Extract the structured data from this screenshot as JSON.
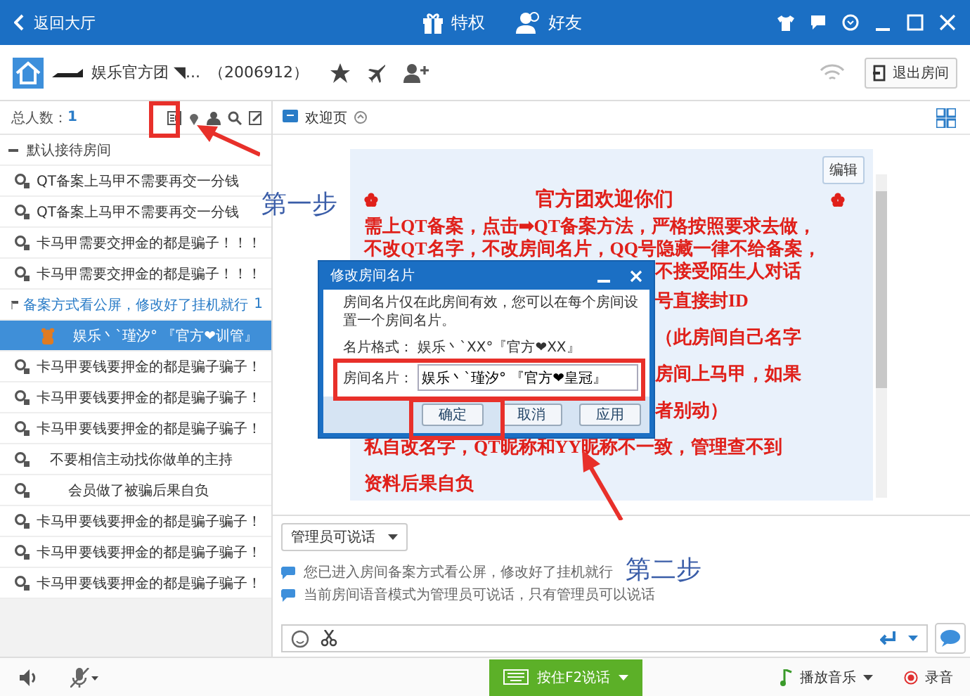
{
  "title_bar": {
    "back": "返回大厅",
    "tabs": [
      {
        "label": "特权",
        "kind": "gift"
      },
      {
        "label": "好友",
        "kind": "friends"
      }
    ]
  },
  "room_header": {
    "name": "娱乐官方团 ◥...",
    "id": "（2006912）",
    "exit_button": "退出房间"
  },
  "member_bar": {
    "count_label": "总人数：",
    "count": "1"
  },
  "page_tab": {
    "label": "欢迎页"
  },
  "channel_list": {
    "header": "默认接待房间",
    "items": [
      {
        "kind": "channel",
        "label": "QT备案上马甲不需要再交一分钱",
        "selected": false
      },
      {
        "kind": "channel",
        "label": "QT备案上马甲不需要再交一分钱",
        "selected": false
      },
      {
        "kind": "channel",
        "label": "卡马甲需要交押金的都是骗子！！！",
        "selected": false
      },
      {
        "kind": "channel",
        "label": "卡马甲需要交押金的都是骗子！！！",
        "selected": false
      },
      {
        "kind": "group",
        "label": "备案方式看公屏，修改好了挂机就行",
        "badge": "1",
        "selected": false,
        "children": [
          {
            "label": "娱乐丶`瑾汐° 『官方❤训管』",
            "selected": true
          }
        ]
      },
      {
        "kind": "channel",
        "label": "卡马甲要钱要押金的都是骗子骗子！",
        "selected": false
      },
      {
        "kind": "channel",
        "label": "卡马甲要钱要押金的都是骗子骗子！",
        "selected": false
      },
      {
        "kind": "channel",
        "label": "卡马甲要钱要押金的都是骗子骗子！",
        "selected": false
      },
      {
        "kind": "channel",
        "label": "   不要相信主动找你做单的主持",
        "selected": false
      },
      {
        "kind": "channel",
        "label": "       会员做了被骗后果自负",
        "selected": false
      },
      {
        "kind": "channel",
        "label": "卡马甲要钱要押金的都是骗子骗子！",
        "selected": false
      },
      {
        "kind": "channel",
        "label": "卡马甲要钱要押金的都是骗子骗子！",
        "selected": false
      },
      {
        "kind": "channel",
        "label": "卡马甲要钱要押金的都是骗子骗子！",
        "selected": false
      }
    ]
  },
  "welcome_panel": {
    "edit_button": "编辑",
    "title": "官方团欢迎你们",
    "lines": [
      {
        "kind": "full",
        "text": "需上QT备案，点击➡QT备案方法，严格按照要求去做，"
      },
      {
        "kind": "full",
        "text": "不改QT名字，不改房间名片，QQ号隐藏一律不给备案，"
      },
      {
        "kind": "partial",
        "text": "不接受陌生人对话"
      },
      {
        "kind": "partial",
        "text": "号直接封ID"
      },
      {
        "kind": "partial",
        "text": "（此房间自己名字"
      },
      {
        "kind": "partial",
        "text": "房间上马甲，如果"
      },
      {
        "kind": "partial",
        "text": "者别动）"
      },
      {
        "kind": "full",
        "text": "私自改名字，QT昵称和YY昵称不一致，管理查不到"
      },
      {
        "kind": "full",
        "text": "资料后果自负"
      }
    ]
  },
  "dialog": {
    "title": "修改房间名片",
    "description": "房间名片仅在此房间有效，您可以在每个房间设置一个房间名片。",
    "format_label": "名片格式：",
    "format_value": "娱乐丶`XX°『官方❤XX』",
    "name_label": "房间名片：",
    "name_value": "娱乐丶`瑾汐° 『官方❤皇冠』",
    "buttons": [
      "确定",
      "取消",
      "应用"
    ]
  },
  "chat": {
    "mode_select": "管理员可说话",
    "messages": [
      "您已进入房间备案方式看公屏，修改好了挂机就行",
      "当前房间语音模式为管理员可说话，只有管理员可以说话"
    ]
  },
  "bottom_bar": {
    "talk_button": "按住F2说话",
    "music": "播放音乐",
    "record": "录音"
  },
  "annotations": [
    {
      "text": "第一步"
    },
    {
      "text": "第二步"
    }
  ]
}
